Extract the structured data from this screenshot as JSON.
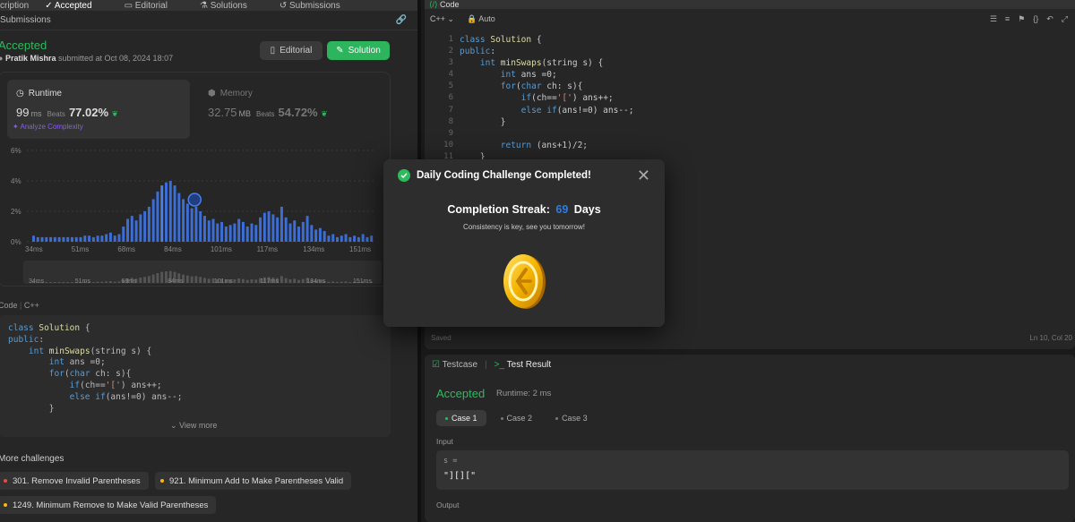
{
  "left": {
    "tabs": [
      "cription",
      "Accepted",
      "Editorial",
      "Solutions",
      "Submissions"
    ],
    "section_title": "Submissions",
    "status": "Accepted",
    "author": "Pratik Mishra",
    "submitted_text": "submitted at Oct 08, 2024 18:07",
    "editorial_label": "Editorial",
    "solution_label": "Solution",
    "runtime": {
      "label": "Runtime",
      "value": "99",
      "unit": "ms",
      "beats_label": "Beats",
      "beats": "77.02%"
    },
    "memory": {
      "label": "Memory",
      "value": "32.75",
      "unit": "MB",
      "beats_label": "Beats",
      "beats": "54.72%"
    },
    "analyze_label": "Analyze Complexity",
    "code_head": "Code",
    "code_lang": "C++",
    "code_preview": [
      "class Solution {",
      "public:",
      "    int minSwaps(string s) {",
      "        int ans =0;",
      "        for(char ch: s){",
      "            if(ch=='[') ans++;",
      "            else if(ans!=0) ans--;",
      "        }"
    ],
    "view_more": "View more",
    "more_challenges_title": "More challenges",
    "challenges": [
      {
        "label": "301. Remove Invalid Parentheses",
        "color": "#ef4743"
      },
      {
        "label": "921. Minimum Add to Make Parentheses Valid",
        "color": "#ffb800"
      },
      {
        "label": "1249. Minimum Remove to Make Valid Parentheses",
        "color": "#ffb800"
      }
    ]
  },
  "chart_data": {
    "type": "bar",
    "yticks": [
      "6%",
      "4%",
      "2%",
      "0%"
    ],
    "xticks": [
      "34ms",
      "51ms",
      "68ms",
      "84ms",
      "101ms",
      "117ms",
      "134ms",
      "151ms"
    ],
    "ylim": [
      0,
      6
    ],
    "values": [
      0.4,
      0.3,
      0.3,
      0.3,
      0.3,
      0.3,
      0.3,
      0.3,
      0.3,
      0.3,
      0.3,
      0.3,
      0.4,
      0.4,
      0.3,
      0.4,
      0.4,
      0.5,
      0.6,
      0.4,
      0.5,
      1.0,
      1.5,
      1.7,
      1.4,
      1.8,
      2.0,
      2.3,
      2.8,
      3.3,
      3.7,
      3.9,
      4.0,
      3.7,
      3.2,
      2.8,
      2.5,
      2.2,
      2.3,
      2.0,
      1.7,
      1.4,
      1.5,
      1.2,
      1.3,
      1.0,
      1.1,
      1.2,
      1.5,
      1.3,
      1.0,
      1.2,
      1.1,
      1.6,
      1.9,
      2.0,
      1.8,
      1.6,
      2.3,
      1.6,
      1.2,
      1.4,
      1.0,
      1.3,
      1.7,
      1.1,
      0.8,
      0.9,
      0.7,
      0.4,
      0.5,
      0.3,
      0.4,
      0.5,
      0.3,
      0.4,
      0.3,
      0.5,
      0.3,
      0.4
    ],
    "highlight_index": 30,
    "color": "#3c6ed6"
  },
  "editor": {
    "tab": "Code",
    "lang": "C++",
    "mode": "Auto",
    "line_numbers": [
      "1",
      "2",
      "3",
      "4",
      "5",
      "6",
      "7",
      "8",
      "9",
      "10",
      "11"
    ],
    "saved": "Saved",
    "position": "Ln 10, Col 20"
  },
  "test": {
    "testcase_tab": "Testcase",
    "result_tab": "Test Result",
    "status": "Accepted",
    "runtime": "Runtime: 2 ms",
    "cases": [
      "Case 1",
      "Case 2",
      "Case 3"
    ],
    "input_label": "Input",
    "input_var": "s =",
    "input_value": "\"][][\"",
    "output_label": "Output"
  },
  "modal": {
    "title": "Daily Coding Challenge Completed!",
    "streak_label": "Completion Streak:",
    "streak_value": "69",
    "streak_unit": "Days",
    "message": "Consistency is key, see you tomorrow!"
  }
}
